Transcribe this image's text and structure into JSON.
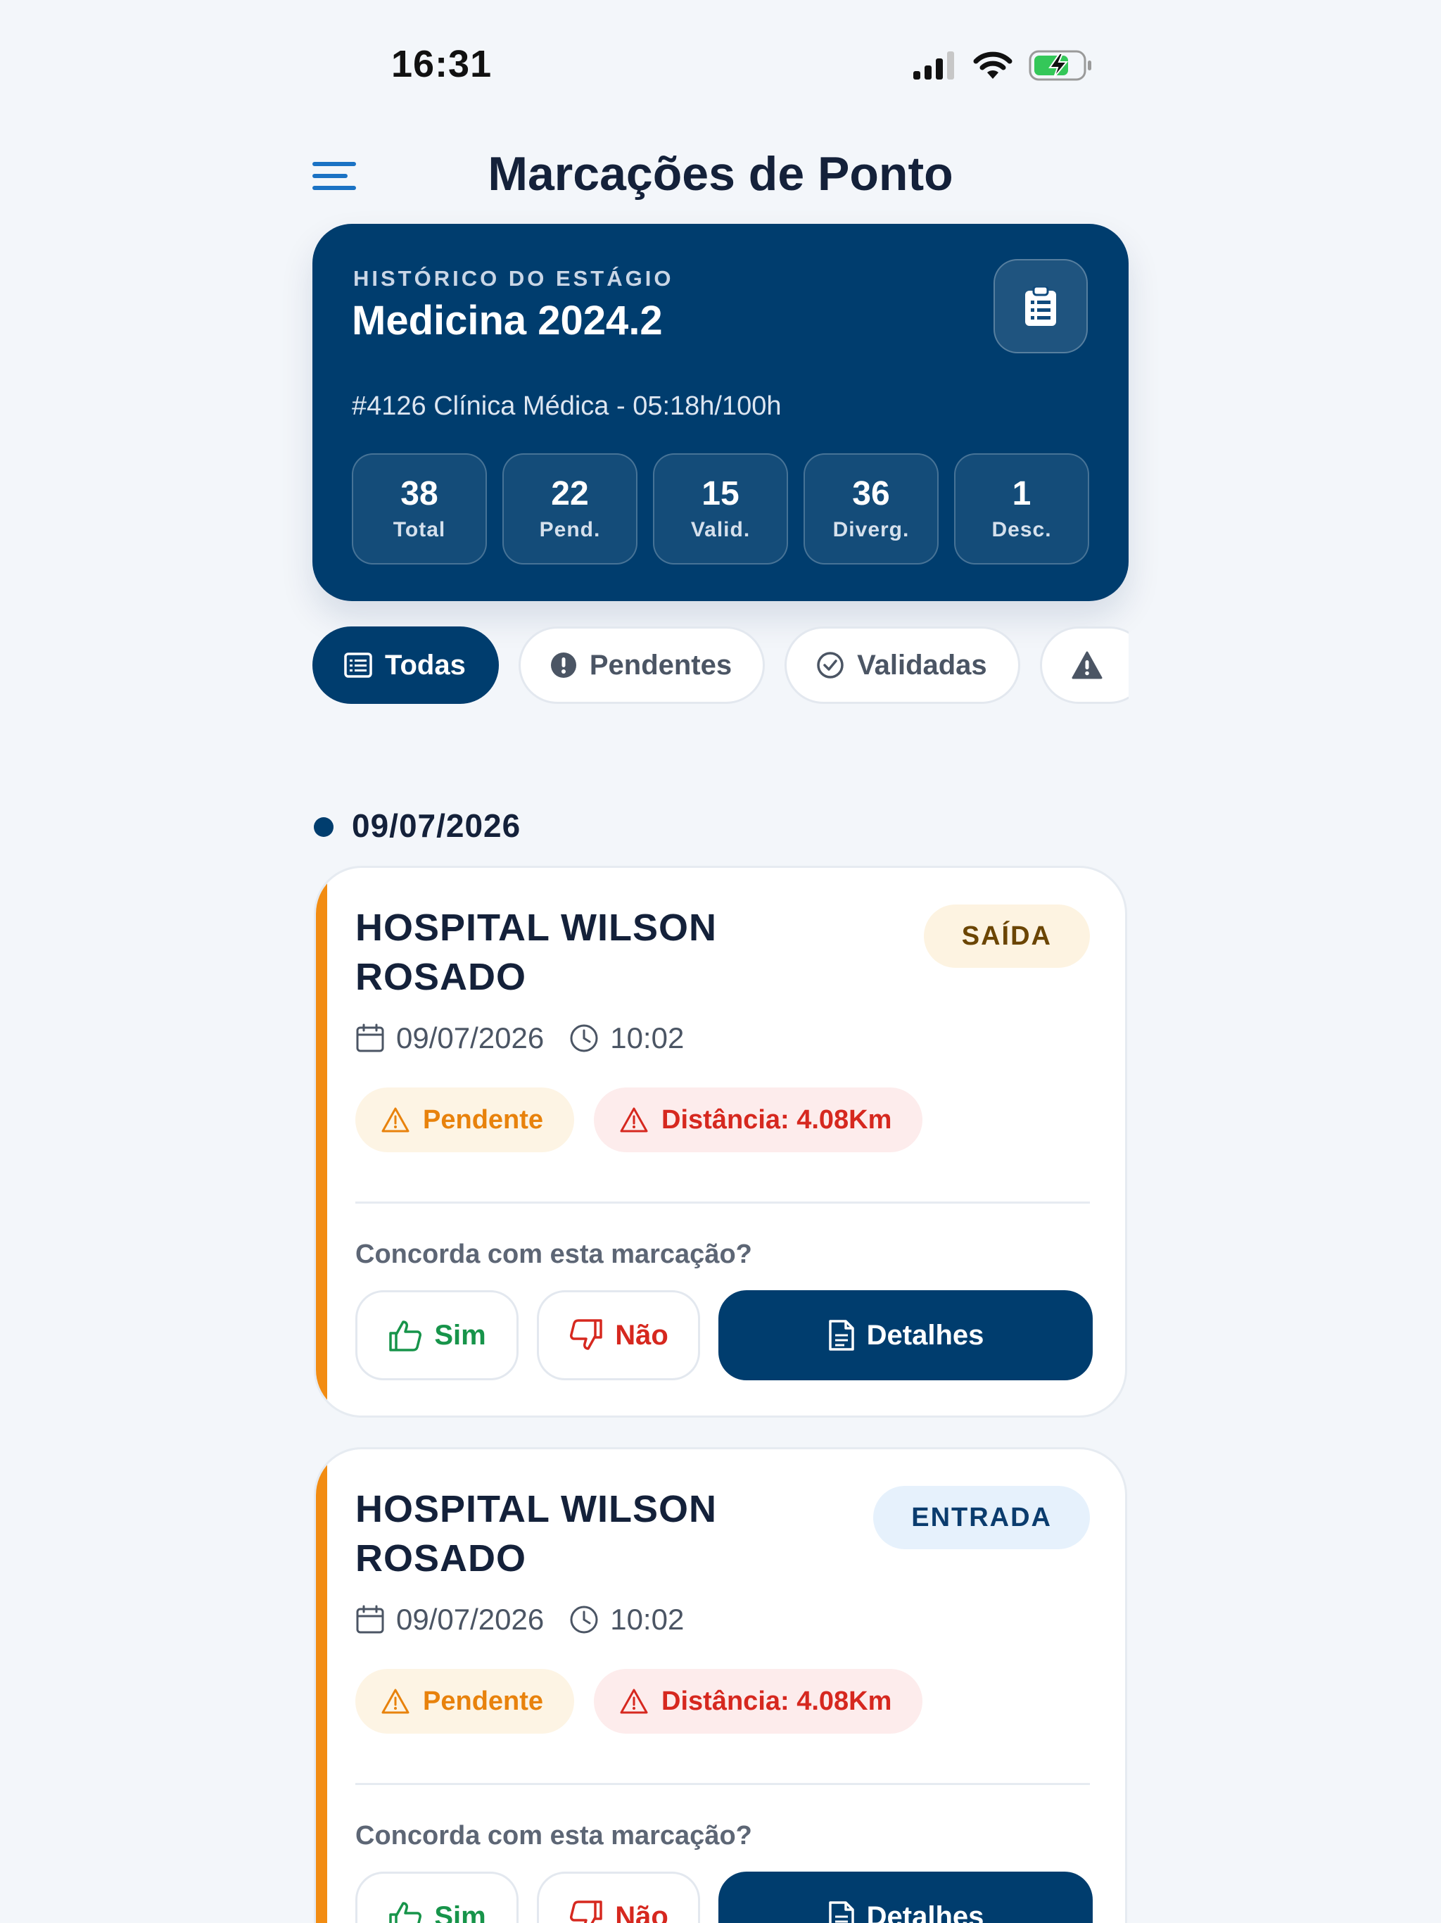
{
  "status_bar": {
    "time": "16:31"
  },
  "header": {
    "title": "Marcações de Ponto"
  },
  "hero": {
    "eyebrow": "HISTÓRICO DO ESTÁGIO",
    "title": "Medicina 2024.2",
    "subtitle": "#4126 Clínica Médica - 05:18h/100h",
    "stats": [
      {
        "value": "38",
        "label": "Total"
      },
      {
        "value": "22",
        "label": "Pend."
      },
      {
        "value": "15",
        "label": "Valid."
      },
      {
        "value": "36",
        "label": "Diverg."
      },
      {
        "value": "1",
        "label": "Desc."
      }
    ]
  },
  "filters": [
    {
      "label": "Todas",
      "icon": "list-icon",
      "active": true
    },
    {
      "label": "Pendentes",
      "icon": "alert-circle-icon",
      "active": false
    },
    {
      "label": "Validadas",
      "icon": "check-circle-icon",
      "active": false
    },
    {
      "label": "",
      "icon": "warning-triangle-icon",
      "active": false
    }
  ],
  "date_group": {
    "date": "09/07/2026"
  },
  "records": [
    {
      "location": "HOSPITAL WILSON ROSADO",
      "type": "SAÍDA",
      "date": "09/07/2026",
      "time": "10:02",
      "status": "Pendente",
      "distance": "Distância: 4.08Km",
      "question": "Concorda com esta marcação?",
      "yes_label": "Sim",
      "no_label": "Não",
      "details_label": "Detalhes"
    },
    {
      "location": "HOSPITAL WILSON ROSADO",
      "type": "ENTRADA",
      "date": "09/07/2026",
      "time": "10:02",
      "status": "Pendente",
      "distance": "Distância: 4.08Km",
      "question": "Concorda com esta marcação?",
      "yes_label": "Sim",
      "no_label": "Não",
      "details_label": "Detalhes"
    }
  ],
  "colors": {
    "primary": "#003d6e",
    "pending": "#f28c12",
    "danger": "#d6281f",
    "success": "#17944a",
    "background": "#f3f6fa"
  }
}
